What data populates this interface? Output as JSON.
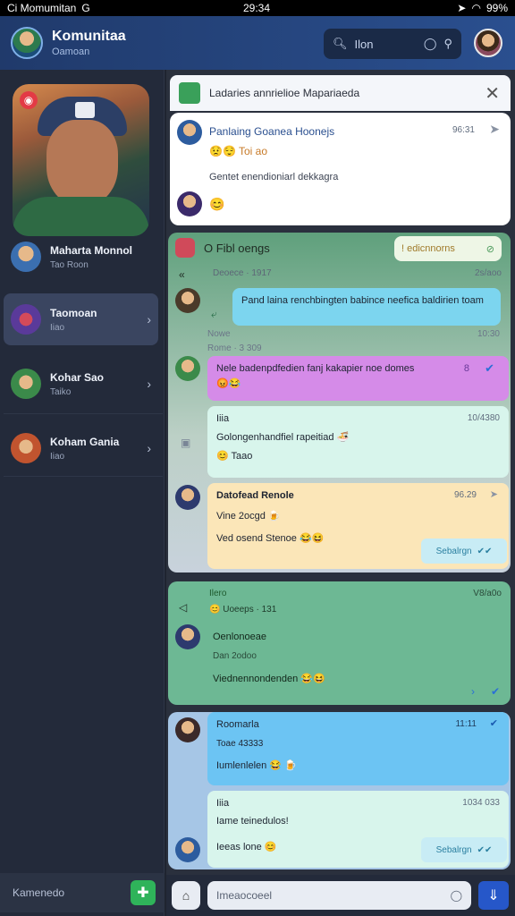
{
  "status_bar": {
    "carrier": "Ci Momumitan",
    "signal": "G",
    "time": "29:34",
    "battery": "99%"
  },
  "header": {
    "app_title": "Komunitaa",
    "app_subtitle": "Oamoan",
    "search_placeholder": "Ilon"
  },
  "sidebar": {
    "hero_badge": "◉",
    "contacts": [
      {
        "name": "Maharta Monnol",
        "sub": "Tao Roon"
      },
      {
        "name": "Taomoan",
        "sub": "Iiao"
      },
      {
        "name": "Kohar Sao",
        "sub": "Taiko"
      },
      {
        "name": "Koham Gania",
        "sub": "Iiao"
      }
    ],
    "footer_label": "Kamenedo"
  },
  "banner": {
    "text": "Ladaries annrielioe Mapariaeda"
  },
  "top_card": {
    "title": "Panlaing Goanea Hoonejs",
    "time": "96:31",
    "emoji_line": "😟😌 Toi ao",
    "subtext": "Gentet enendioniarl dekkagra"
  },
  "section": {
    "title": "O Fibl oengs",
    "pill": "! edicnnorns",
    "sender_meta": "Deoece · 1917",
    "sender_time": "2s/aoo",
    "msg1": "Pand laina renchbingten babince neefica baldirien toam",
    "msg1_label": "Nowe",
    "msg1_time": "10:30",
    "msg1_meta": "Rome · 3 309",
    "msg2": "Nele badenpdfedien fanj kakapier noe domes",
    "msg2_reaction": "😡😂",
    "msg2_badge": "8",
    "msg3_name": "Iiia",
    "msg3_time": "10/4380",
    "msg3_text": "Golongenhandfiel rapeitiad 🍜",
    "msg3_footer": "😊 Taao",
    "msg4_name": "Datofead Renole",
    "msg4_time": "96.29",
    "msg4_sub": "Vine 2ocgd 🍺",
    "msg4_text": "Ved osend Stenoe 😂😆",
    "msg4_action": "Sebalrgn"
  },
  "section2": {
    "tag": "Ilero",
    "time": "V8/a0o",
    "meta": "😊 Uoeeps · 131",
    "name": "Oenlonoeae",
    "sub": "Dan 2odoo",
    "text": "Viednennondenden 😂😆"
  },
  "section3": {
    "name": "Roomarla",
    "time": "11:11",
    "sub": "Toae 43333",
    "text": "Iumlenlelen 😂 🍺"
  },
  "bottom_card": {
    "name": "Iiia",
    "time": "1034 033",
    "text": "Iame teinedulos!",
    "footer": "Ieeas lone 😊",
    "action": "Sebalrgn"
  },
  "composer": {
    "placeholder": "Imeaocoeel"
  },
  "colors": {
    "accent": "#2657c9",
    "header": "#2a4f8f",
    "sidebar": "#232a3a"
  }
}
